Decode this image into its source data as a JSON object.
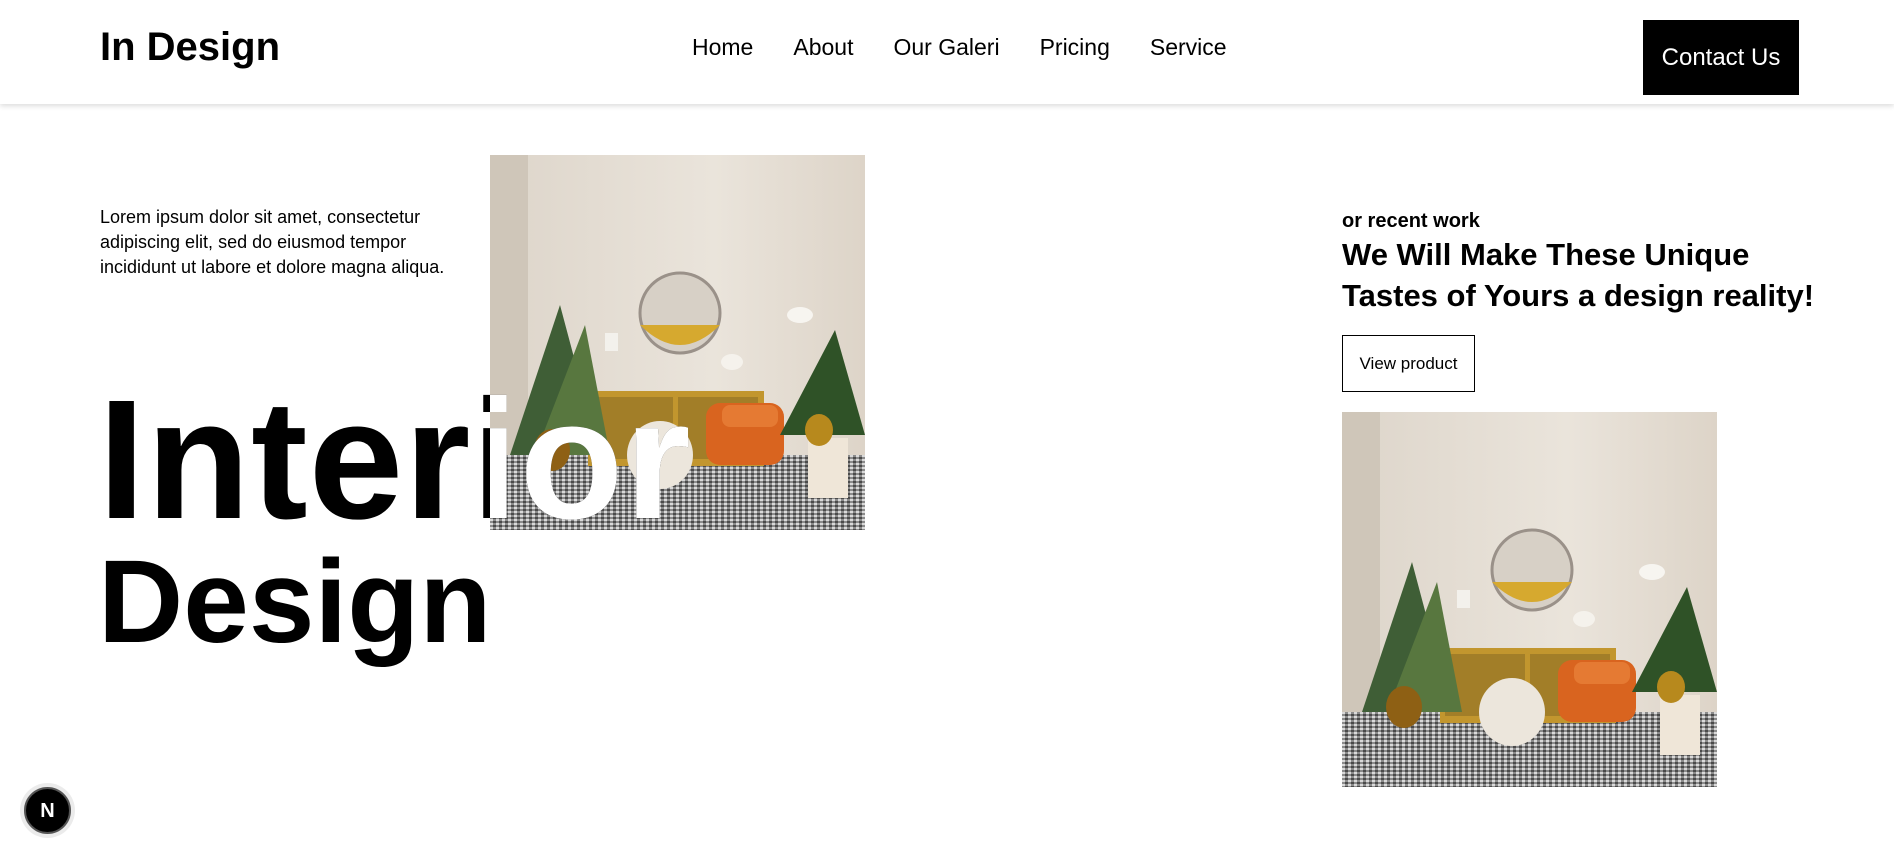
{
  "header": {
    "logo": "In Design",
    "nav": [
      "Home",
      "About",
      "Our Galeri",
      "Pricing",
      "Service"
    ],
    "contact_label": "Contact Us"
  },
  "hero": {
    "intro": "Lorem ipsum dolor sit amet, consectetur adipiscing elit, sed do eiusmod tempor incididunt ut labore et dolore magna aliqua.",
    "title_line1": "Interior",
    "title_line2": "Design"
  },
  "recent": {
    "eyebrow": "or recent work",
    "headline": "We Will Make These Unique Tastes of Yours a design reality!",
    "button_label": "View product"
  },
  "badge": {
    "letter": "N"
  },
  "colors": {
    "accent": "#000000",
    "armchair": "#d9641f",
    "sideboard": "#c2962e"
  }
}
